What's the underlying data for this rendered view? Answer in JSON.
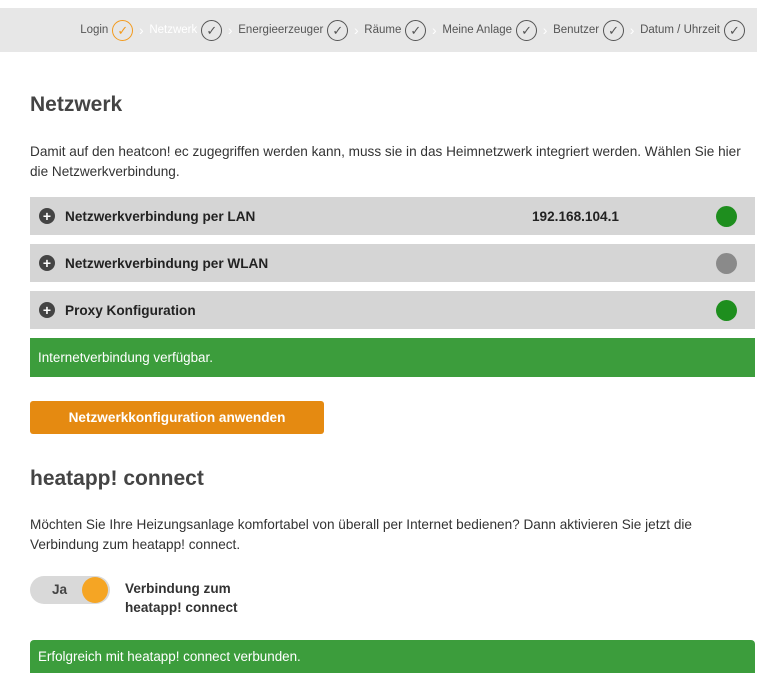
{
  "steps": [
    {
      "label": "Login",
      "state": "active"
    },
    {
      "label": "Netzwerk",
      "state": "current"
    },
    {
      "label": "Energieerzeuger",
      "state": "done"
    },
    {
      "label": "Räume",
      "state": "done"
    },
    {
      "label": "Meine Anlage",
      "state": "done"
    },
    {
      "label": "Benutzer",
      "state": "done"
    },
    {
      "label": "Datum / Uhrzeit",
      "state": "done"
    }
  ],
  "network": {
    "title": "Netzwerk",
    "description": "Damit auf den heatcon! ec zugegriffen werden kann, muss sie in das Heimnetzwerk integriert werden. Wählen Sie hier die Netzwerkverbindung.",
    "lan": {
      "label": "Netzwerkverbindung per LAN",
      "value": "192.168.104.1",
      "status_color": "#1e8e1e"
    },
    "wlan": {
      "label": "Netzwerkverbindung per WLAN",
      "status_color": "#8a8a8a"
    },
    "proxy": {
      "label": "Proxy Konfiguration",
      "status_color": "#1e8e1e"
    },
    "status_message": "Internetverbindung verfügbar.",
    "apply_button": "Netzwerkkonfiguration anwenden"
  },
  "connect": {
    "title": "heatapp! connect",
    "description": "Möchten Sie Ihre Heizungsanlage komfortabel von überall per Internet bedienen? Dann aktivieren Sie jetzt die Verbindung zum heatapp! connect.",
    "toggle_text": "Ja",
    "toggle_label_line1": "Verbindung zum",
    "toggle_label_line2": "heatapp! connect",
    "status_message": "Erfolgreich mit heatapp! connect verbunden."
  },
  "colors": {
    "accent": "#f29a1d",
    "button": "#e58a11",
    "success": "#3c9d3c",
    "panel": "#d5d5d5"
  }
}
